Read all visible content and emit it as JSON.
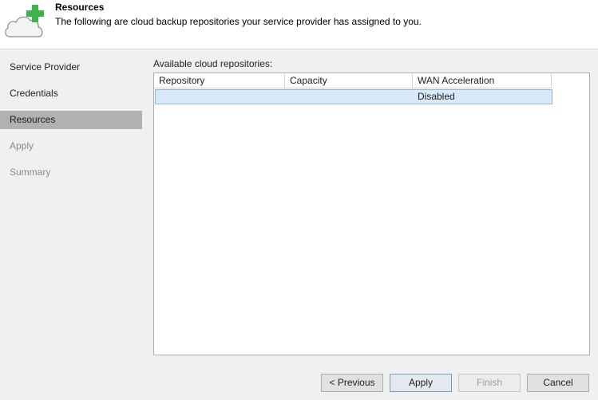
{
  "header": {
    "title": "Resources",
    "description": "The following are cloud backup repositories your service provider has assigned to you.",
    "icon": "cloud-add-icon"
  },
  "sidebar": {
    "items": [
      {
        "label": "Service Provider",
        "state": "enabled"
      },
      {
        "label": "Credentials",
        "state": "enabled"
      },
      {
        "label": "Resources",
        "state": "active"
      },
      {
        "label": "Apply",
        "state": "disabled"
      },
      {
        "label": "Summary",
        "state": "disabled"
      }
    ]
  },
  "main": {
    "section_label": "Available cloud repositories:",
    "columns": [
      "Repository",
      "Capacity",
      "WAN Acceleration"
    ],
    "rows": [
      {
        "repository": "",
        "capacity": "",
        "wan_acceleration": "Disabled"
      }
    ]
  },
  "footer": {
    "previous": "< Previous",
    "apply": "Apply",
    "finish": "Finish",
    "cancel": "Cancel"
  },
  "colors": {
    "active_nav": "#b1b1b1",
    "selected_row": "#d9e9f7",
    "cloud_green": "#3cb44b"
  }
}
